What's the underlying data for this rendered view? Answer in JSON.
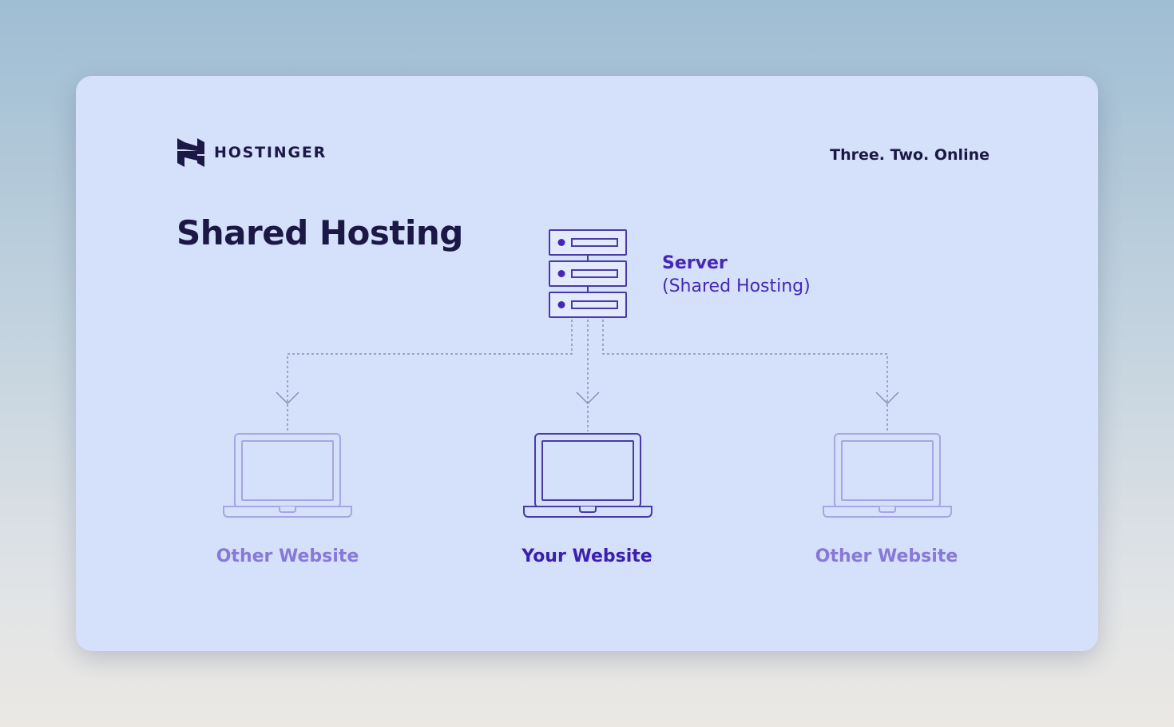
{
  "brand": {
    "name": "HOSTINGER",
    "logo_icon": "hostinger-logo-icon"
  },
  "tagline": "Three. Two. Online",
  "title": "Shared Hosting",
  "server": {
    "name": "Server",
    "subtitle": "(Shared Hosting)",
    "icon": "server-rack-icon"
  },
  "sites": [
    {
      "label": "Other Website",
      "icon": "laptop-icon",
      "highlighted": false
    },
    {
      "label": "Your Website",
      "icon": "laptop-icon",
      "highlighted": true
    },
    {
      "label": "Other Website",
      "icon": "laptop-icon",
      "highlighted": false
    }
  ],
  "colors": {
    "card_background": "#d5e0fa",
    "text_dark": "#1c1846",
    "accent": "#4527b8",
    "muted": "#8878d8",
    "connector": "#8a8fb8"
  }
}
